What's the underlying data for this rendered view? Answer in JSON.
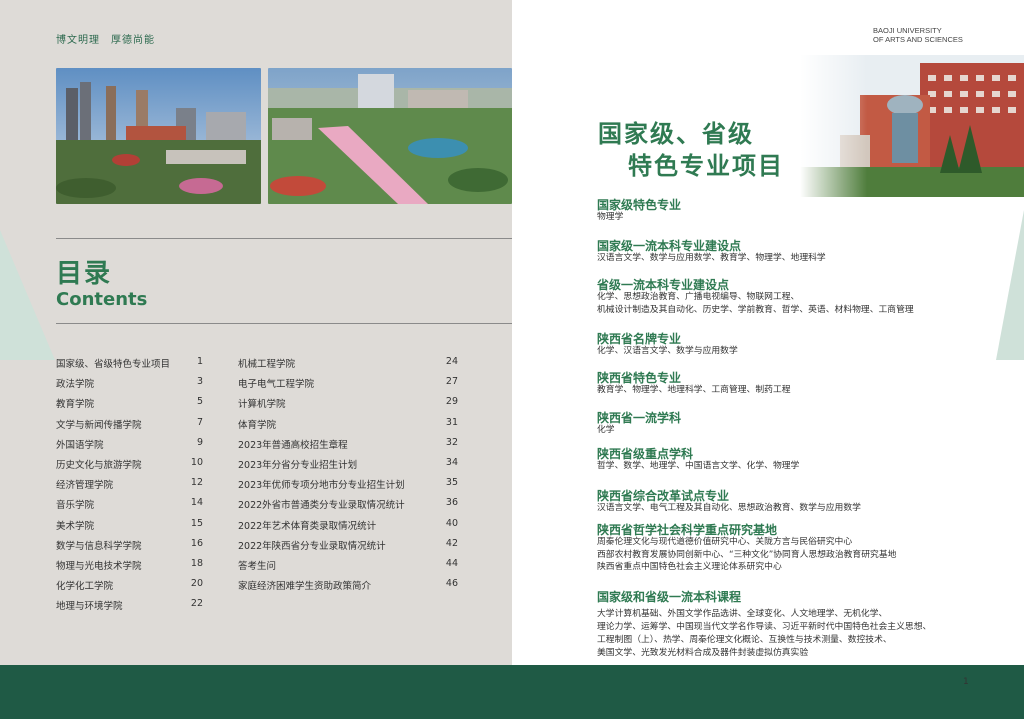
{
  "left_page": {
    "motto": "博文明理　厚德尚能",
    "title_cn": "目录",
    "title_en": "Contents",
    "toc_col1": [
      {
        "label": "国家级、省级特色专业项目",
        "page": "1"
      },
      {
        "label": "政法学院",
        "page": "3"
      },
      {
        "label": "教育学院",
        "page": "5"
      },
      {
        "label": "文学与新闻传播学院",
        "page": "7"
      },
      {
        "label": "外国语学院",
        "page": "9"
      },
      {
        "label": "历史文化与旅游学院",
        "page": "10"
      },
      {
        "label": "经济管理学院",
        "page": "12"
      },
      {
        "label": "音乐学院",
        "page": "14"
      },
      {
        "label": "美术学院",
        "page": "15"
      },
      {
        "label": "数学与信息科学学院",
        "page": "16"
      },
      {
        "label": "物理与光电技术学院",
        "page": "18"
      },
      {
        "label": "化学化工学院",
        "page": "20"
      },
      {
        "label": "地理与环境学院",
        "page": "22"
      }
    ],
    "toc_col2": [
      {
        "label": "机械工程学院",
        "page": "24"
      },
      {
        "label": "电子电气工程学院",
        "page": "27"
      },
      {
        "label": "计算机学院",
        "page": "29"
      },
      {
        "label": "体育学院",
        "page": "31"
      },
      {
        "label": "2023年普通高校招生章程",
        "page": "32"
      },
      {
        "label": "2023年分省分专业招生计划",
        "page": "34"
      },
      {
        "label": "2023年优师专项分地市分专业招生计划",
        "page": "35"
      },
      {
        "label": "2022外省市普通类分专业录取情况统计",
        "page": "36"
      },
      {
        "label": "2022年艺术体育类录取情况统计",
        "page": "40"
      },
      {
        "label": "2022年陕西省分专业录取情况统计",
        "page": "42"
      },
      {
        "label": "答考生问",
        "page": "44"
      },
      {
        "label": "家庭经济困难学生资助政策简介",
        "page": "46"
      }
    ]
  },
  "right_page": {
    "university_line1": "BAOJI UNIVERSITY",
    "university_line2": "OF ARTS  AND SCIENCES",
    "title_line1": "国家级、省级",
    "title_line2": "特色专业项目",
    "sections": [
      {
        "heading": "国家级特色专业",
        "lines": [
          "物理学"
        ]
      },
      {
        "heading": "国家级一流本科专业建设点",
        "lines": [
          "汉语言文学、数学与应用数学、教育学、物理学、地理科学"
        ]
      },
      {
        "heading": "省级一流本科专业建设点",
        "lines": [
          "化学、思想政治教育、广播电视编导、物联网工程、",
          "机械设计制造及其自动化、历史学、学前教育、哲学、英语、材料物理、工商管理"
        ]
      },
      {
        "heading": "陕西省名牌专业",
        "lines": [
          "化学、汉语言文学、数学与应用数学"
        ]
      },
      {
        "heading": "陕西省特色专业",
        "lines": [
          "教育学、物理学、地理科学、工商管理、制药工程"
        ]
      },
      {
        "heading": "陕西省一流学科",
        "lines": [
          "化学"
        ]
      },
      {
        "heading": "陕西省级重点学科",
        "lines": [
          "哲学、数学、地理学、中国语言文学、化学、物理学"
        ]
      },
      {
        "heading": "陕西省综合改革试点专业",
        "lines": [
          "汉语言文学、电气工程及其自动化、思想政治教育、数学与应用数学"
        ]
      },
      {
        "heading": "陕西省哲学社会科学重点研究基地",
        "lines": [
          "周秦伦理文化与现代道德价值研究中心、关陇方言与民俗研究中心",
          "西部农村教育发展协同创新中心、“三种文化”协同育人思想政治教育研究基地",
          "陕西省重点中国特色社会主义理论体系研究中心"
        ]
      },
      {
        "heading": "国家级和省级一流本科课程",
        "lines": [
          "大学计算机基础、外国文学作品选讲、全球变化、人文地理学、无机化学、",
          "理论力学、运筹学、中国现当代文学名作导读、习近平新时代中国特色社会主义思想、",
          "工程制图（上）、热学、周秦伦理文化概论、互换性与技术测量、数控技术、",
          "美国文学、光致发光材料合成及器件封装虚拟仿真实验"
        ]
      }
    ],
    "page_number": "1"
  },
  "colors": {
    "accent_green": "#2f7a52",
    "dark_band": "#1f5a45",
    "left_bg": "#dedbd7"
  }
}
